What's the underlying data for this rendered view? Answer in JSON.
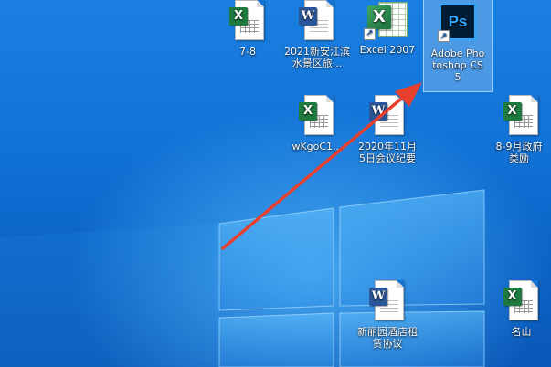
{
  "desktop": {
    "icons": [
      {
        "label": "7-8",
        "type": "excel-file",
        "icon": "excel-file-icon"
      },
      {
        "label": "2021新安江滨水景区旅...",
        "type": "word-file",
        "icon": "word-file-icon"
      },
      {
        "label": "Excel 2007",
        "type": "excel-app",
        "icon": "excel-app-icon"
      },
      {
        "label": "Adobe Photoshop CS5",
        "type": "photoshop-app",
        "icon": "photoshop-app-icon",
        "selected": true
      },
      {
        "label": "wKgoC1...",
        "type": "excel-file",
        "icon": "excel-file-icon"
      },
      {
        "label": "2020年11月5日会议纪要",
        "type": "word-file",
        "icon": "word-file-icon"
      },
      {
        "label": "8-9月政府类励",
        "type": "excel-file",
        "icon": "excel-file-icon"
      },
      {
        "label": "新丽园酒店租赁协议",
        "type": "word-file",
        "icon": "word-file-icon"
      },
      {
        "label": "名山",
        "type": "excel-file",
        "icon": "excel-file-icon"
      }
    ],
    "app_glyphs": {
      "excel": "X",
      "word": "W",
      "photoshop": "Ps"
    },
    "annotation": {
      "type": "red-arrow",
      "points_to": "Adobe Photoshop CS5",
      "color": "#e8402f"
    },
    "colors": {
      "wallpaper": "#1272d6",
      "selection": "#8cbef0"
    }
  }
}
